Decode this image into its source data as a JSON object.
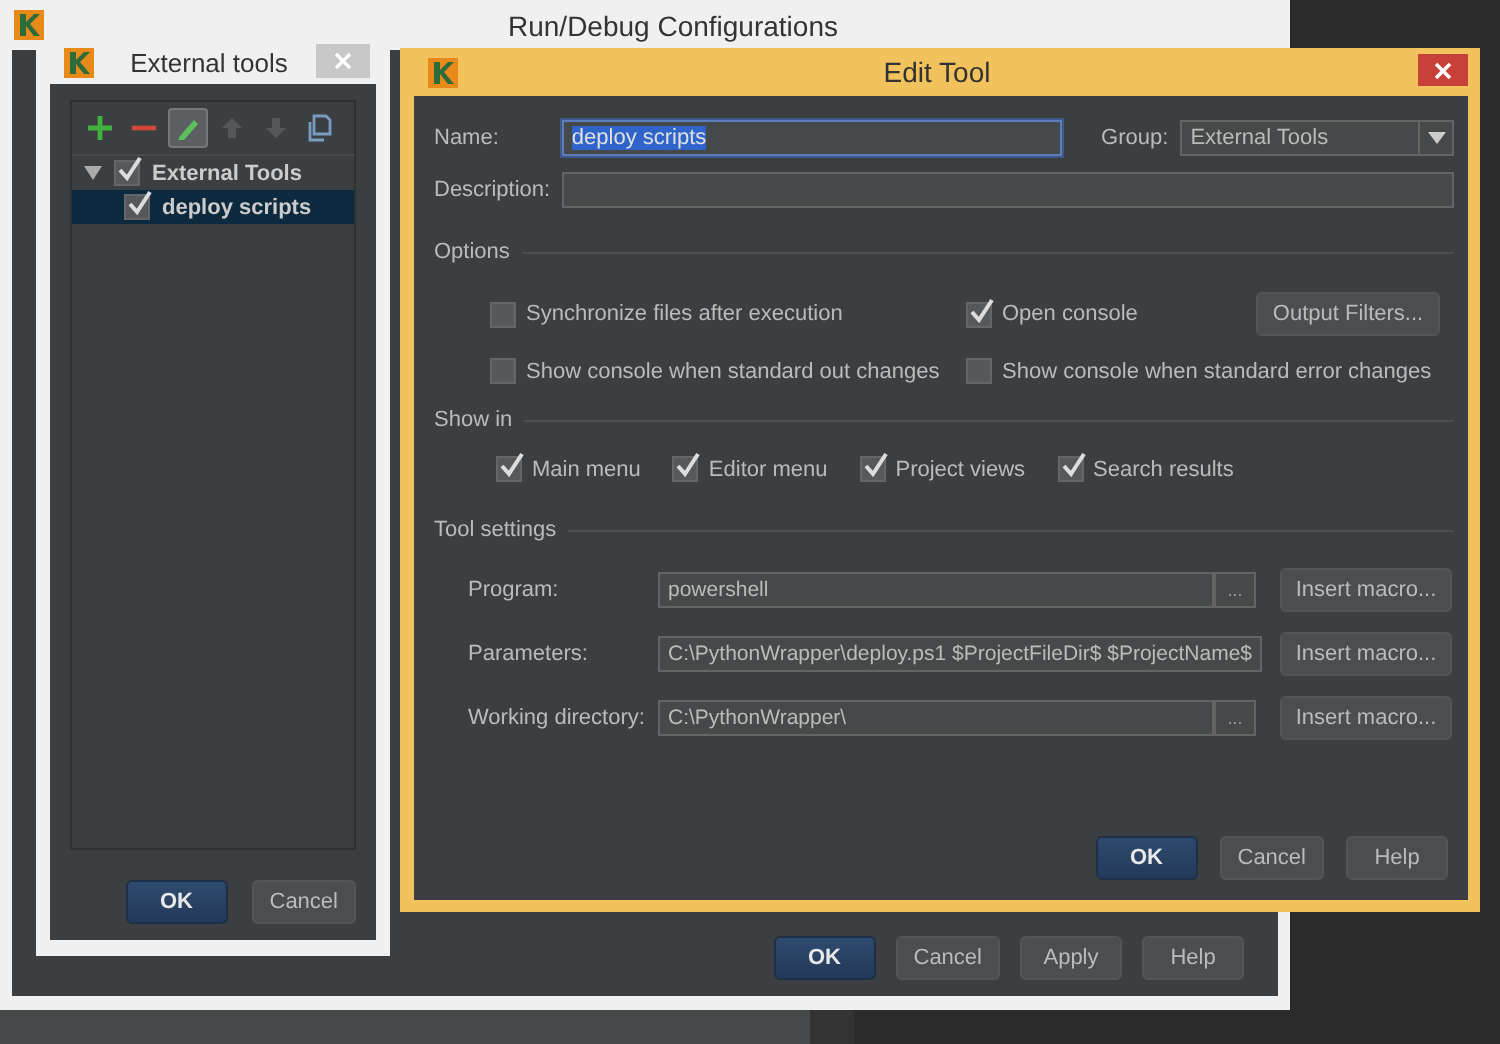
{
  "main_window": {
    "title": "Run/Debug Configurations",
    "buttons": [
      {
        "label": "OK",
        "default": true
      },
      {
        "label": "Cancel",
        "default": false
      },
      {
        "label": "Apply",
        "default": false
      },
      {
        "label": "Help",
        "default": false
      }
    ]
  },
  "external_tools_dialog": {
    "title": "External tools",
    "toolbar": [
      {
        "kind": "add",
        "disabled": false,
        "active": false
      },
      {
        "kind": "remove",
        "disabled": false,
        "active": false
      },
      {
        "kind": "edit",
        "disabled": false,
        "active": true
      },
      {
        "kind": "up",
        "disabled": true,
        "active": false
      },
      {
        "kind": "down",
        "disabled": true,
        "active": false
      },
      {
        "kind": "copy",
        "disabled": false,
        "active": false
      }
    ],
    "tree": [
      {
        "label": "External Tools",
        "checked": true,
        "expanded": true,
        "selected": false,
        "children": [
          {
            "label": "deploy scripts",
            "checked": true,
            "selected": true
          }
        ]
      }
    ],
    "buttons": [
      {
        "label": "OK",
        "default": true
      },
      {
        "label": "Cancel",
        "default": false
      }
    ]
  },
  "edit_tool_dialog": {
    "title": "Edit Tool",
    "name": {
      "label": "Name:",
      "value": "deploy scripts",
      "text_selected": true
    },
    "group": {
      "label": "Group:",
      "value": "External Tools"
    },
    "description": {
      "label": "Description:"
    },
    "options": {
      "title": "Options",
      "checkboxes": [
        {
          "label": "Synchronize files after execution",
          "checked": false
        },
        {
          "label": "Open console",
          "checked": true
        },
        {
          "label": "Show console when standard out changes",
          "checked": false
        },
        {
          "label": "Show console when standard error changes",
          "checked": false
        }
      ],
      "button": "Output Filters..."
    },
    "show_in": {
      "title": "Show in",
      "checkboxes": [
        {
          "label": "Main menu",
          "checked": true
        },
        {
          "label": "Editor menu",
          "checked": true
        },
        {
          "label": "Project views",
          "checked": true
        },
        {
          "label": "Search results",
          "checked": true
        }
      ]
    },
    "tool_settings": {
      "title": "Tool settings",
      "rows": [
        {
          "label": "Program:",
          "value": "powershell",
          "browse": "...",
          "macro_button": "Insert macro..."
        },
        {
          "label": "Parameters:",
          "value": "C:\\PythonWrapper\\deploy.ps1 $ProjectFileDir$ $ProjectName$",
          "macro_button": "Insert macro..."
        },
        {
          "label": "Working directory:",
          "value": "C:\\PythonWrapper\\",
          "browse": "...",
          "macro_button": "Insert macro..."
        }
      ]
    },
    "buttons": [
      {
        "label": "OK",
        "default": true
      },
      {
        "label": "Cancel",
        "default": false
      },
      {
        "label": "Help",
        "default": false
      }
    ]
  }
}
